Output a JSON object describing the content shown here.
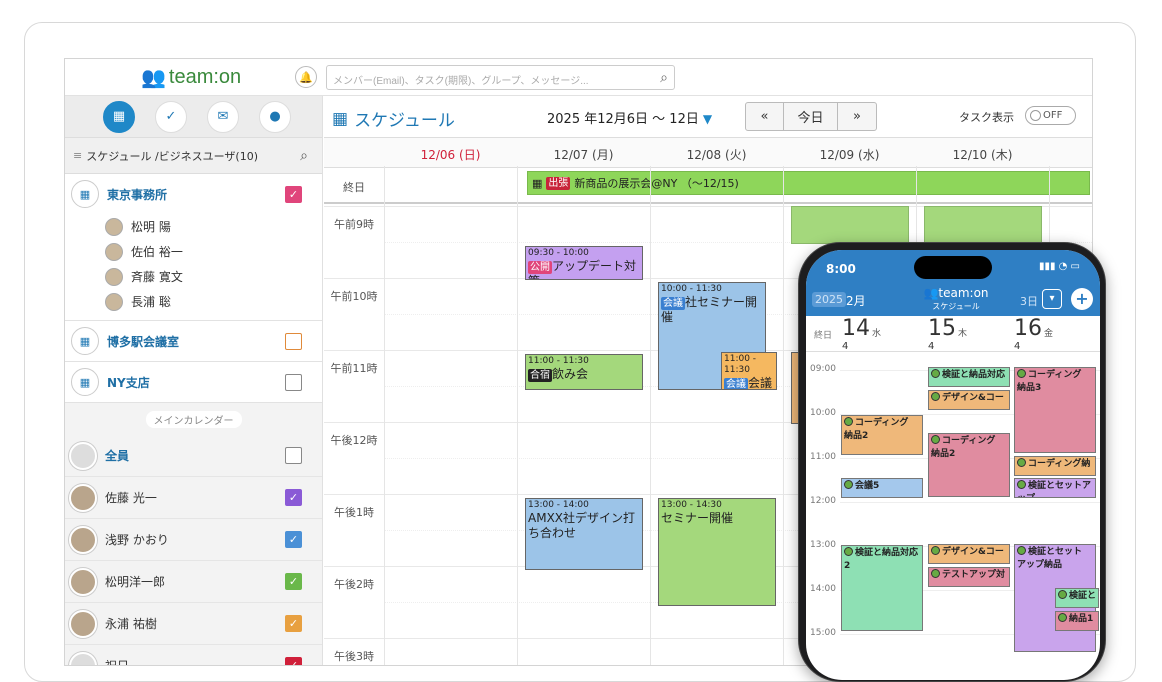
{
  "app": {
    "logo": "team:on",
    "search_placeholder": "メンバー(Email)、タスク(期限)、グループ、メッセージ..."
  },
  "sidebar": {
    "header": "スケジュール /ビジネスユーザ(10)",
    "groups": [
      {
        "name": "東京事務所",
        "checked": true,
        "color": "#e0457b",
        "members": [
          "松明 陽",
          "佐伯 裕一",
          "斉藤 寛文",
          "長浦 聡"
        ]
      },
      {
        "name": "博多駅会議室",
        "checked": false,
        "color": "#e08a3a",
        "members": []
      },
      {
        "name": "NY支店",
        "checked": false,
        "color": "#888888",
        "members": []
      }
    ],
    "divider": "メインカレンダー",
    "persons": [
      {
        "name": "全員",
        "checked": false,
        "color": "#888888",
        "bold": true
      },
      {
        "name": "佐藤 光一",
        "checked": true,
        "color": "#8a5ad6"
      },
      {
        "name": "浅野 かおり",
        "checked": true,
        "color": "#4a90d6"
      },
      {
        "name": "松明洋一郎",
        "checked": true,
        "color": "#6ab84a"
      },
      {
        "name": "永浦 祐樹",
        "checked": true,
        "color": "#e8a040"
      },
      {
        "name": "祝日",
        "checked": true,
        "color": "#d0203a"
      }
    ]
  },
  "main": {
    "title": "スケジュール",
    "date_range": "2025 年12月6日 〜 12日",
    "nav": {
      "prev": "«",
      "today": "今日",
      "next": "»"
    },
    "task_label": "タスク表示",
    "toggle": "OFF",
    "days": [
      "12/06 (日)",
      "12/07 (月)",
      "12/08 (火)",
      "12/09 (水)",
      "12/10 (木)"
    ],
    "allday_label": "終日",
    "allday_event": {
      "tag": "出張",
      "text": "新商品の展示会@NY （〜12/15)"
    },
    "times": [
      "午前9時",
      "午前10時",
      "午前11時",
      "午後12時",
      "午後1時",
      "午後2時",
      "午後3時"
    ],
    "events": [
      {
        "time": "09:30 - 10:00",
        "tag": "公開",
        "tag_color": "#e0457b",
        "title": "アップデート対策",
        "color": "#c4a0f0"
      },
      {
        "time": "10:00 - 11:30",
        "tag": "会議",
        "tag_color": "#3a7fd0",
        "title": "社セミナー開催",
        "color": "#9cc4e8"
      },
      {
        "time": "11:00 - 11:30",
        "tag": "合宿",
        "tag_color": "#222222",
        "title": "飲み会",
        "color": "#a4d87c"
      },
      {
        "time": "11:00 - 11:30",
        "tag": "会議",
        "tag_color": "#3a7fd0",
        "title": "会議",
        "color": "#f5b860"
      },
      {
        "time": "13:00 - 14:00",
        "tag": "",
        "tag_color": "",
        "title": "AMXX社デザイン打ち合わせ",
        "color": "#9cc4e8"
      },
      {
        "time": "13:00 - 14:30",
        "tag": "",
        "tag_color": "",
        "title": "セミナー開催",
        "color": "#a4d87c"
      }
    ]
  },
  "phone": {
    "clock": "8:00",
    "year": "2025",
    "month": "2月",
    "logo": "team:on",
    "subtitle": "スケジュール",
    "view": "3日",
    "days": [
      {
        "num": "14",
        "dow": "水",
        "count": "4"
      },
      {
        "num": "15",
        "dow": "木",
        "count": "4"
      },
      {
        "num": "16",
        "dow": "金",
        "count": "4"
      }
    ],
    "allday_label": "終日",
    "times": [
      "09:00",
      "10:00",
      "11:00",
      "12:00",
      "13:00",
      "14:00",
      "15:00"
    ],
    "events": [
      {
        "title": "コーディング 納品2",
        "color": "#efb87a"
      },
      {
        "title": "会議5",
        "color": "#a4c8ec"
      },
      {
        "title": "検証と納品対応2",
        "color": "#8ee0b4"
      },
      {
        "title": "検証と納品対応",
        "color": "#8ee0b4"
      },
      {
        "title": "デザイン&コー",
        "color": "#efb87a"
      },
      {
        "title": "コーディング 納品2",
        "color": "#e08ca0"
      },
      {
        "title": "デザイン&コー",
        "color": "#efb87a"
      },
      {
        "title": "テストアップ対",
        "color": "#e08ca0"
      },
      {
        "title": "コーディング 納品3",
        "color": "#e08ca0"
      },
      {
        "title": "コーディング納",
        "color": "#efb87a"
      },
      {
        "title": "検証とセットアップ",
        "color": "#c9a4ec"
      },
      {
        "title": "検証とセット アップ納品",
        "color": "#c9a4ec"
      },
      {
        "title": "検証と",
        "color": "#8ee0b4"
      },
      {
        "title": "納品1",
        "color": "#e08ca0"
      }
    ]
  }
}
